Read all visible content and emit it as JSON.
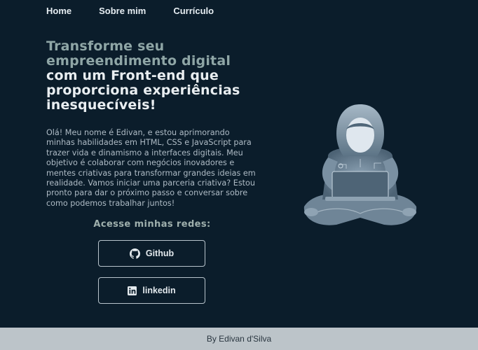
{
  "nav": {
    "items": [
      {
        "label": "Home"
      },
      {
        "label": "Sobre mim"
      },
      {
        "label": "Currículo"
      }
    ]
  },
  "hero": {
    "headline_accent": "Transforme seu empreendimento digital",
    "headline_main": "com um Front-end que proporciona experiências inesquecíveis!",
    "intro": "Olá! Meu nome é Edivan, e estou aprimorando minhas habilidades em HTML, CSS e JavaScript para trazer vida e dinamismo a interfaces digitais. Meu objetivo é colaborar com negócios inovadores e mentes criativas para transformar grandes ideias em realidade. Vamos iniciar uma parceria criativa? Estou pronto para dar o próximo passo e conversar sobre como podemos trabalhar juntos!",
    "image_icon": "hooded-hacker-laptop-illustration"
  },
  "social": {
    "title": "Acesse minhas redes:",
    "github": {
      "label": "Github",
      "icon": "github-icon"
    },
    "linkedin": {
      "label": "linkedin",
      "icon": "linkedin-icon"
    }
  },
  "footer": {
    "text": "By Edivan d'Silva"
  },
  "colors": {
    "background": "#0b1d2b",
    "accent_text": "#8fa6a6",
    "footer_bg": "#bcc4c9"
  }
}
